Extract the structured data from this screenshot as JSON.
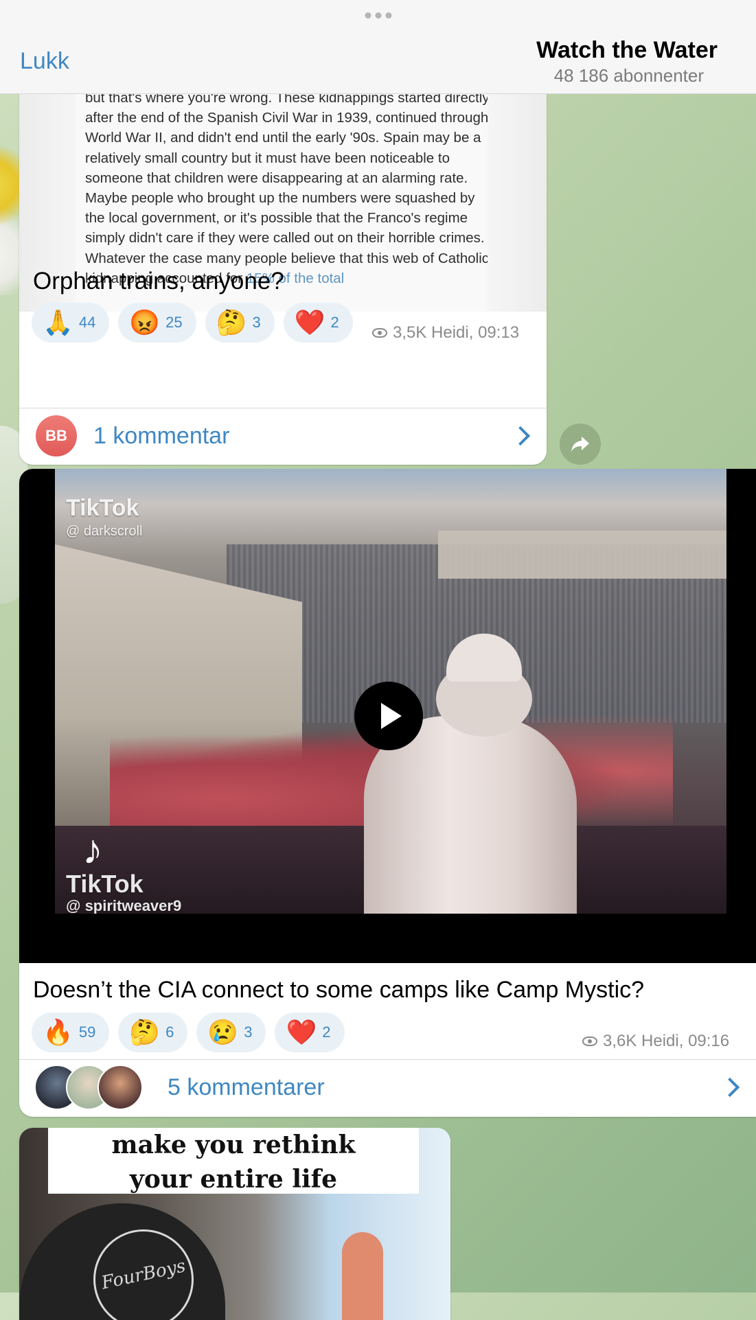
{
  "header": {
    "close_label": "Lukk",
    "channel_title": "Watch the Water",
    "subscribers": "48 186 abonnenter"
  },
  "posts": [
    {
      "article_text": "but that's where you're wrong. These kidnappings started directly after the end of the Spanish Civil War in 1939, continued through World War II, and didn't end until the early '90s. Spain may be a relatively small country but it must have been noticeable to someone that children were disappearing at an alarming rate. Maybe people who brought up the numbers were squashed by the local government, or it's possible that the Franco's regime simply didn't care if they were called out on their horrible crimes. Whatever the case many people believe that this web of Catholic kidnapping accounted for ",
      "article_link": "15% of the total",
      "text": "Orphan trains, anyone?",
      "reactions": [
        {
          "emoji": "🙏",
          "count": "44"
        },
        {
          "emoji": "😡",
          "count": "25"
        },
        {
          "emoji": "🤔",
          "count": "3"
        },
        {
          "emoji": "❤️",
          "count": "2"
        }
      ],
      "meta": "3,5K Heidi, 09:13",
      "comments_label": "1  kommentar",
      "avatar_initials": "BB"
    },
    {
      "video": {
        "watermark_top": "TikTok",
        "watermark_top_user": "@ darkscroll",
        "watermark_bottom": "TikTok",
        "watermark_bottom_user": "@ spiritweaver9"
      },
      "text": "Doesn’t the CIA connect to some camps like Camp Mystic?",
      "reactions": [
        {
          "emoji": "🔥",
          "count": "59"
        },
        {
          "emoji": "🤔",
          "count": "6"
        },
        {
          "emoji": "😢",
          "count": "3"
        },
        {
          "emoji": "❤️",
          "count": "2"
        }
      ],
      "meta": "3,6K Heidi, 09:16",
      "comments_label": "5  kommentarer"
    },
    {
      "caption_line1": "make you rethink",
      "caption_line2": "your entire life",
      "hat_text": "FourBoys"
    }
  ],
  "icons": {
    "share": "share-arrow-icon",
    "play": "play-icon",
    "views": "eye-icon",
    "chevron": "chevron-right-icon"
  },
  "colors": {
    "accent": "#3e87c2",
    "reaction_bg": "#e9f1f7",
    "header_bg": "#f6f6f6"
  }
}
